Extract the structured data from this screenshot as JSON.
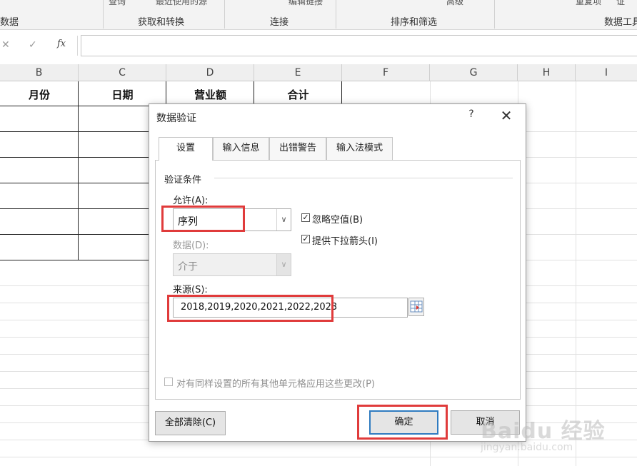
{
  "ribbon": {
    "top_items": [
      "查询",
      "最近使用的源",
      "编辑链接",
      "高级",
      "重复项",
      "证"
    ],
    "groups": [
      "数据",
      "获取和转换",
      "连接",
      "排序和筛选",
      "数据工具"
    ]
  },
  "formula_bar": {
    "cancel_icon": "✕",
    "enter_icon": "✓",
    "fx_label": "fx",
    "value": ""
  },
  "sheet": {
    "columns": [
      "B",
      "C",
      "D",
      "E",
      "F",
      "G",
      "H",
      "I"
    ],
    "header_cells": [
      "月份",
      "日期",
      "营业额",
      "合计"
    ]
  },
  "dialog": {
    "title": "数据验证",
    "help": "?",
    "close": "✕",
    "tabs": [
      "设置",
      "输入信息",
      "出错警告",
      "输入法模式"
    ],
    "active_tab": "设置",
    "criteria_label": "验证条件",
    "allow_label": "允许(A):",
    "allow_value": "序列",
    "data_label": "数据(D):",
    "data_value": "介于",
    "ignore_blank_label": "忽略空值(B)",
    "ignore_blank_checked": true,
    "dropdown_label": "提供下拉箭头(I)",
    "dropdown_checked": true,
    "source_label": "来源(S):",
    "source_value": "2018,2019,2020,2021,2022,2023",
    "apply_all_label": "对有同样设置的所有其他单元格应用这些更改(P)",
    "apply_all_checked": false,
    "clear_all_button": "全部清除(C)",
    "ok_button": "确定",
    "cancel_button": "取消"
  },
  "watermark": {
    "brand": "Baidu 经验",
    "url": "jingyan.baidu.com"
  },
  "colors": {
    "highlight_box": "#e03b3b",
    "ok_border": "#2f7bc0"
  }
}
